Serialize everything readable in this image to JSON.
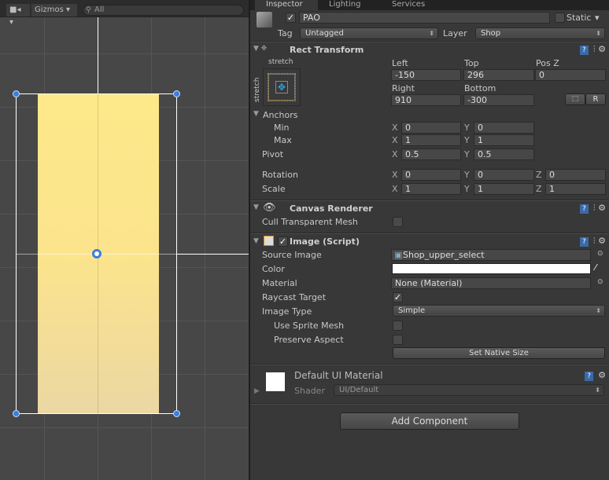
{
  "scene": {
    "camera_icon": "camera-icon",
    "gizmos_label": "Gizmos",
    "search_placeholder": "All"
  },
  "tabs": [
    "Inspector",
    "Lighting",
    "Services"
  ],
  "object": {
    "name": "PAO",
    "active": true,
    "static_label": "Static",
    "static": false,
    "tag_label": "Tag",
    "tag": "Untagged",
    "layer_label": "Layer",
    "layer": "Shop"
  },
  "rect_transform": {
    "title": "Rect Transform",
    "anchor_preset_h": "stretch",
    "anchor_preset_v": "stretch",
    "left_label": "Left",
    "left": "-150",
    "top_label": "Top",
    "top": "296",
    "posz_label": "Pos Z",
    "posz": "0",
    "right_label": "Right",
    "right": "910",
    "bottom_label": "Bottom",
    "bottom": "-300",
    "r_button": "R",
    "anchors_label": "Anchors",
    "min_label": "Min",
    "min_x": "0",
    "min_y": "0",
    "max_label": "Max",
    "max_x": "1",
    "max_y": "1",
    "pivot_label": "Pivot",
    "pivot_x": "0.5",
    "pivot_y": "0.5",
    "rotation_label": "Rotation",
    "rot_x": "0",
    "rot_y": "0",
    "rot_z": "0",
    "scale_label": "Scale",
    "scale_x": "1",
    "scale_y": "1",
    "scale_z": "1",
    "x": "X",
    "y": "Y",
    "z": "Z"
  },
  "canvas_renderer": {
    "title": "Canvas Renderer",
    "cull_label": "Cull Transparent Mesh",
    "cull": false
  },
  "image": {
    "title": "Image (Script)",
    "enabled": true,
    "source_label": "Source Image",
    "source": "Shop_upper_select",
    "color_label": "Color",
    "color": "#ffffff",
    "material_label": "Material",
    "material": "None (Material)",
    "raycast_label": "Raycast Target",
    "raycast": true,
    "type_label": "Image Type",
    "type": "Simple",
    "sprite_mesh_label": "Use Sprite Mesh",
    "preserve_label": "Preserve Aspect",
    "native_button": "Set Native Size"
  },
  "material": {
    "title": "Default UI Material",
    "shader_label": "Shader",
    "shader": "UI/Default"
  },
  "add_component": "Add Component",
  "colors": {
    "rect_fill": "#fde88e",
    "handle": "#3b7ee0",
    "help": "#3b6aa8"
  }
}
